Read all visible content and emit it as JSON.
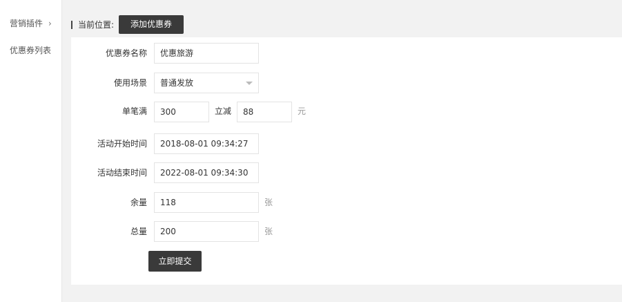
{
  "sidebar": {
    "group_label": "营销插件",
    "chevron_glyph": "›",
    "items": [
      {
        "label": "优惠券列表"
      }
    ]
  },
  "breadcrumb": {
    "label": "当前位置:",
    "button_label": "添加优惠券"
  },
  "form": {
    "coupon_name": {
      "label": "优惠券名称",
      "value": "优惠旅游"
    },
    "scene": {
      "label": "使用场景",
      "value": "普通发放"
    },
    "threshold": {
      "label": "单笔满",
      "value": "300",
      "discount_label": "立减",
      "discount_value": "88",
      "unit": "元"
    },
    "start_time": {
      "label": "活动开始时间",
      "value": "2018-08-01 09:34:27"
    },
    "end_time": {
      "label": "活动结束时间",
      "value": "2022-08-01 09:34:30"
    },
    "remaining": {
      "label": "余量",
      "value": "118",
      "unit": "张"
    },
    "total": {
      "label": "总量",
      "value": "200",
      "unit": "张"
    },
    "submit_label": "立即提交"
  }
}
